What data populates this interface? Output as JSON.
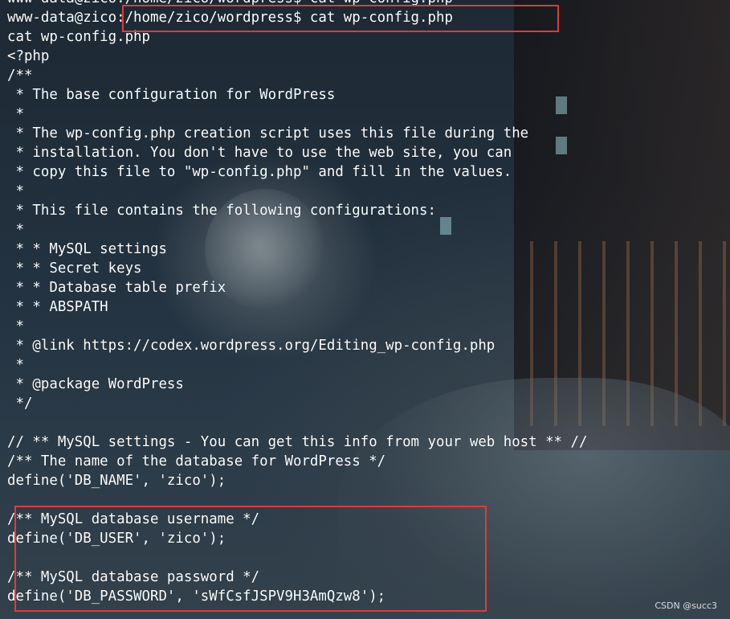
{
  "terminal": {
    "lines": [
      "www-data@zico:/home/zico/wordpress$ cat wp-config.php",
      "www-data@zico:/home/zico/wordpress$ cat wp-config.php",
      "cat wp-config.php",
      "<?php",
      "/**",
      " * The base configuration for WordPress",
      " *",
      " * The wp-config.php creation script uses this file during the",
      " * installation. You don't have to use the web site, you can",
      " * copy this file to \"wp-config.php\" and fill in the values.",
      " *",
      " * This file contains the following configurations:",
      " *",
      " * * MySQL settings",
      " * * Secret keys",
      " * * Database table prefix",
      " * * ABSPATH",
      " *",
      " * @link https://codex.wordpress.org/Editing_wp-config.php",
      " *",
      " * @package WordPress",
      " */",
      "",
      "// ** MySQL settings - You can get this info from your web host ** //",
      "/** The name of the database for WordPress */",
      "define('DB_NAME', 'zico');",
      "",
      "/** MySQL database username */",
      "define('DB_USER', 'zico');",
      "",
      "/** MySQL database password */",
      "define('DB_PASSWORD', 'sWfCsfJSPV9H3AmQzw8');"
    ]
  },
  "highlight_color": "#e03a3a",
  "watermark": "CSDN @succ3"
}
